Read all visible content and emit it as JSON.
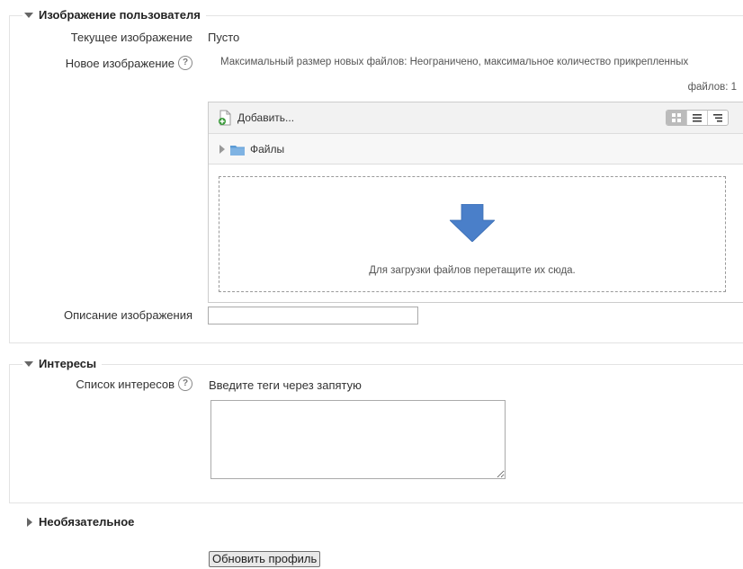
{
  "sections": {
    "user_image": {
      "legend": "Изображение пользователя",
      "current_image_label": "Текущее изображение",
      "current_image_value": "Пусто",
      "new_image_label": "Новое изображение",
      "file_limits_line1": "Максимальный размер новых файлов: Неограничено, максимальное количество прикрепленных",
      "file_limits_line2": "файлов: 1",
      "filepicker": {
        "add_label": "Добавить...",
        "folder_label": "Файлы",
        "drop_hint": "Для загрузки файлов перетащите их сюда.",
        "view_icons": [
          "grid-view-icon",
          "list-view-icon",
          "tree-view-icon"
        ]
      },
      "description_label": "Описание изображения",
      "description_value": ""
    },
    "interests": {
      "legend": "Интересы",
      "list_label": "Список интересов",
      "hint": "Введите теги через запятую",
      "textarea_value": ""
    },
    "optional": {
      "legend": "Необязательное"
    }
  },
  "submit_label": "Обновить профиль",
  "colors": {
    "arrow": "#4a7fc9",
    "folder": "#5b9bd5"
  }
}
